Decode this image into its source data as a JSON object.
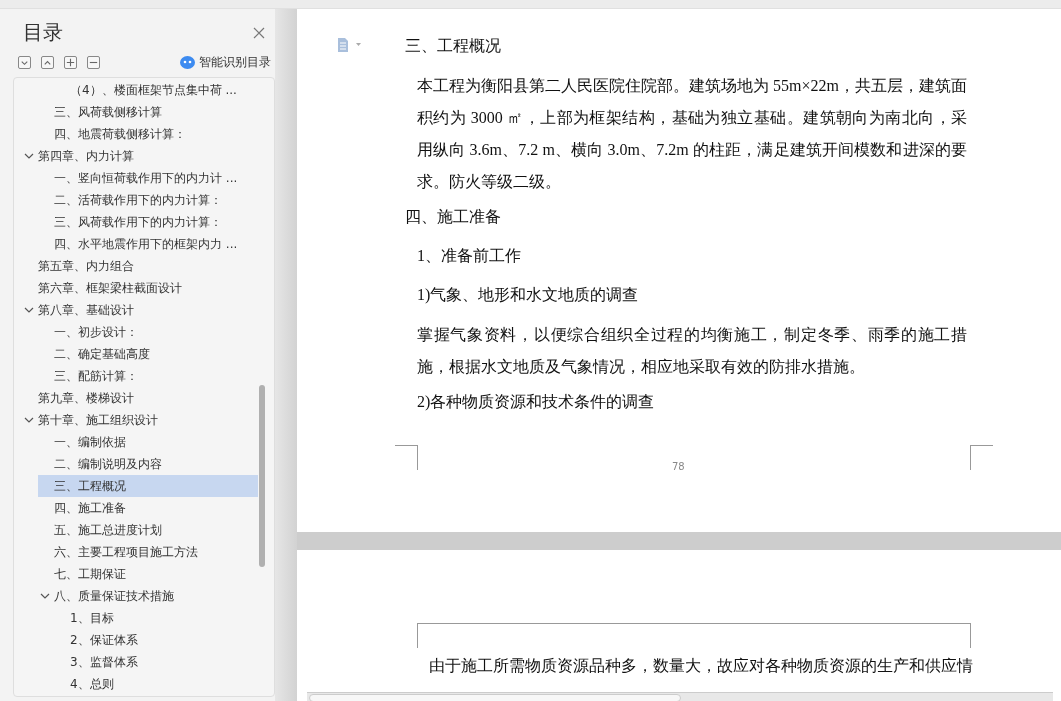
{
  "sidebar": {
    "title": "目录",
    "smart_toc": "智能识别目录",
    "tree": [
      {
        "children": [
          {
            "label": "（4）、楼面框架节点集中荷 ...",
            "selected": false
          }
        ]
      },
      {
        "label": "三、风荷载侧移计算",
        "selected": false
      },
      {
        "label": "四、地震荷载侧移计算：",
        "selected": false
      }
    ],
    "chapters": [
      {
        "label": "第四章、内力计算",
        "selected": false,
        "expanded": true,
        "children": [
          {
            "label": "一、竖向恒荷载作用下的内力计 ...",
            "selected": false
          },
          {
            "label": "二、活荷载作用下的内力计算：",
            "selected": false
          },
          {
            "label": "三、风荷载作用下的内力计算：",
            "selected": false
          },
          {
            "label": "四、水平地震作用下的框架内力 ...",
            "selected": false
          }
        ]
      },
      {
        "label": "第五章、内力组合",
        "selected": false
      },
      {
        "label": "第六章、框架梁柱截面设计",
        "selected": false
      },
      {
        "label": "第八章、基础设计",
        "selected": false,
        "expanded": true,
        "children": [
          {
            "label": "一、初步设计：",
            "selected": false
          },
          {
            "label": "二、确定基础高度",
            "selected": false
          },
          {
            "label": "三、配筋计算：",
            "selected": false
          }
        ]
      },
      {
        "label": "第九章、楼梯设计",
        "selected": false
      },
      {
        "label": "第十章、施工组织设计",
        "selected": false,
        "expanded": true,
        "children": [
          {
            "label": "一、编制依据",
            "selected": false
          },
          {
            "label": "二、编制说明及内容",
            "selected": false
          },
          {
            "label": "三、工程概况",
            "selected": true
          },
          {
            "label": "四、施工准备",
            "selected": false
          },
          {
            "label": "五、施工总进度计划",
            "selected": false
          },
          {
            "label": "六、主要工程项目施工方法",
            "selected": false
          },
          {
            "label": "七、工期保证",
            "selected": false
          },
          {
            "label": "八、质量保证技术措施",
            "selected": false,
            "expanded": true,
            "children": [
              {
                "label": "1、目标",
                "selected": false
              },
              {
                "label": "2、保证体系",
                "selected": false
              },
              {
                "label": "3、监督体系",
                "selected": false
              },
              {
                "label": "4、总则",
                "selected": false
              }
            ]
          }
        ]
      }
    ]
  },
  "page": {
    "blocks": [
      {
        "kind": "heading",
        "text": "三、工程概况"
      },
      {
        "kind": "paragraph",
        "text": "本工程为衡阳县第二人民医院住院部。建筑场地为 55m×22m，共五层，建筑面积约为 3000 ㎡，上部为框架结构，基础为独立基础。建筑朝向为南北向，采用纵向 3.6m、7.2 m、横向 3.0m、7.2m 的柱距，满足建筑开间模数和进深的要求。防火等级二级。"
      },
      {
        "kind": "heading",
        "text": "四、施工准备"
      },
      {
        "kind": "subheading",
        "text": "1、准备前工作"
      },
      {
        "kind": "subheading",
        "text": "1)气象、地形和水文地质的调查"
      },
      {
        "kind": "paragraph",
        "text": "掌握气象资料，以便综合组织全过程的均衡施工，制定冬季、雨季的施工措施，根据水文地质及气象情况，相应地采取有效的防排水措施。"
      },
      {
        "kind": "subheading",
        "text": "2)各种物质资源和技术条件的调查"
      }
    ],
    "page_number": "78"
  },
  "next_page": {
    "blocks": [
      {
        "kind": "paragraph",
        "text": "由于施工所需物质资源品种多，数量大，故应对各种物质资源的生产和供应情"
      }
    ]
  }
}
